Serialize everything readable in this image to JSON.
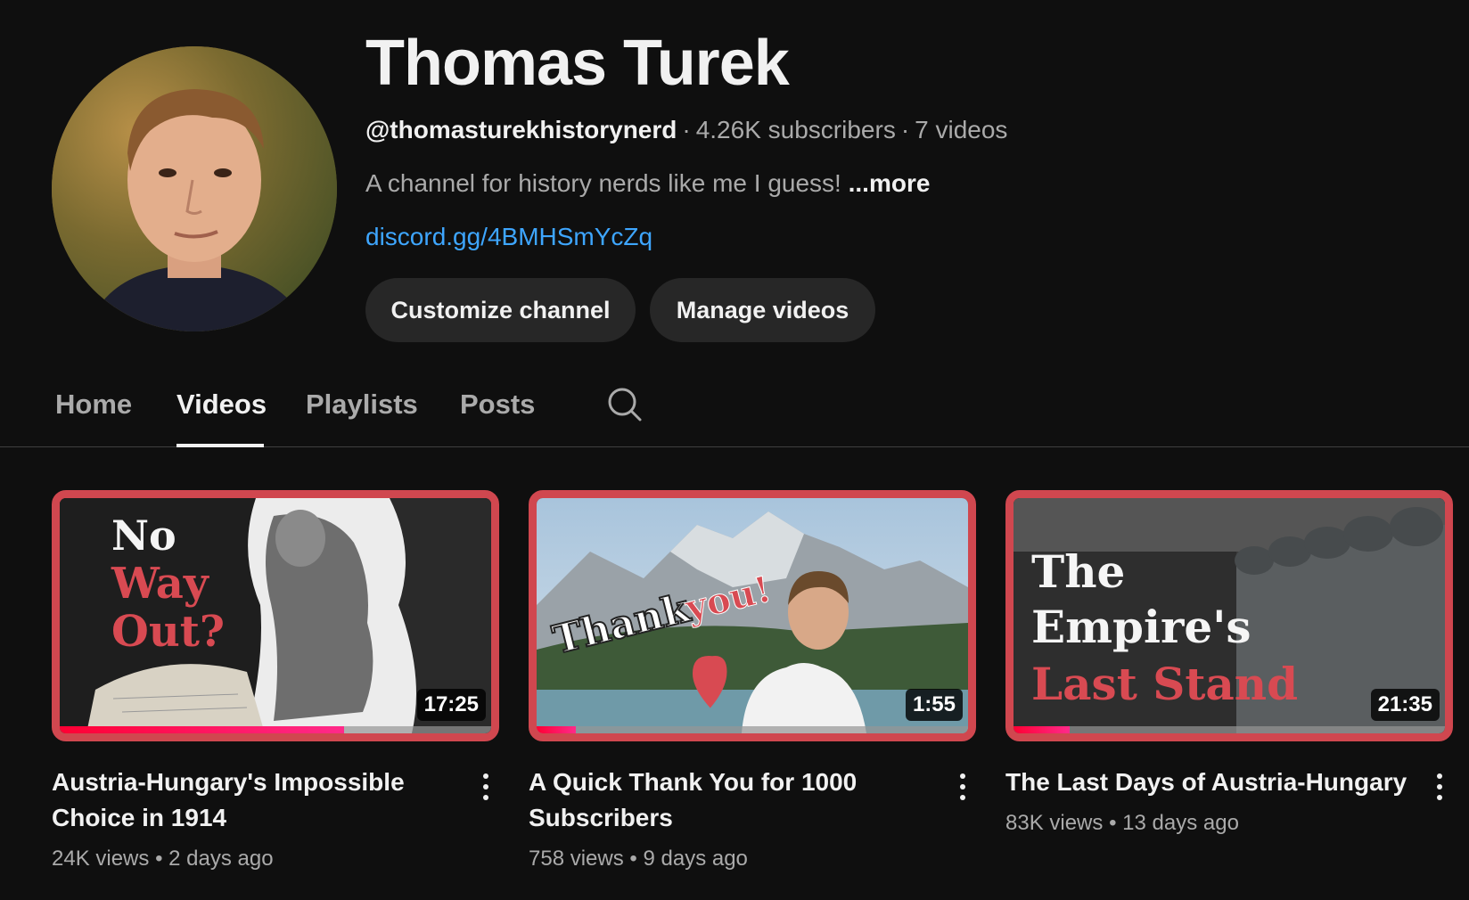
{
  "channel": {
    "title": "Thomas Turek",
    "handle": "@thomasturekhistorynerd",
    "subscribers": "4.26K subscribers",
    "video_count": "7 videos",
    "separator": "·",
    "description": "A channel for history nerds like me I guess!",
    "more_label": "...more",
    "link": "discord.gg/4BMHSmYcZq"
  },
  "buttons": {
    "customize": "Customize channel",
    "manage": "Manage videos"
  },
  "tabs": [
    {
      "label": "Home"
    },
    {
      "label": "Videos",
      "active": true
    },
    {
      "label": "Playlists"
    },
    {
      "label": "Posts"
    }
  ],
  "videos": [
    {
      "title": "Austria-Hungary's Impossible Choice in 1914",
      "views": "24K views",
      "age": "2 days ago",
      "duration": "17:25",
      "progress": 0.66,
      "thumb_text": [
        "No",
        "Way",
        "Out?"
      ]
    },
    {
      "title": "A Quick Thank You for 1000 Subscribers",
      "views": "758 views",
      "age": "9 days ago",
      "duration": "1:55",
      "progress": 0.09,
      "thumb_text": [
        "Thank",
        "you!"
      ]
    },
    {
      "title": "The Last Days of Austria-Hungary",
      "views": "83K views",
      "age": "13 days ago",
      "duration": "21:35",
      "progress": 0.13,
      "thumb_text": [
        "The",
        "Empire's",
        "Last Stand"
      ]
    }
  ],
  "meta_dot": "•",
  "colors": {
    "background": "#0f0f0f",
    "link": "#3ea6ff",
    "thumb_border": "#d0474f",
    "progress": "#ff0033"
  }
}
